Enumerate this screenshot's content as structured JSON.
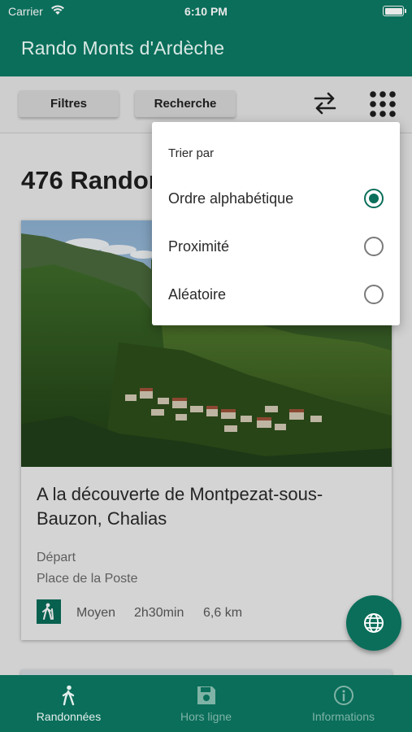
{
  "status_bar": {
    "carrier": "Carrier",
    "time": "6:10 PM"
  },
  "app_bar": {
    "title": "Rando Monts d'Ardèche"
  },
  "toolbar": {
    "filters_label": "Filtres",
    "search_label": "Recherche",
    "sort_icon": "swap-arrows-icon",
    "grid_icon": "grid-dots-icon"
  },
  "list": {
    "count_title": "476 Randonnées"
  },
  "cards": [
    {
      "name": "A la découverte de Montpezat-sous-Bauzon, Chalias",
      "depart_label": "Départ",
      "depart_value": "Place de la Poste",
      "activity_icon": "hiker-icon",
      "level": "Moyen",
      "duration": "2h30min",
      "distance": "6,6 km"
    }
  ],
  "sort_menu": {
    "heading": "Trier par",
    "options": [
      {
        "label": "Ordre alphabétique",
        "selected": true
      },
      {
        "label": "Proximité",
        "selected": false
      },
      {
        "label": "Aléatoire",
        "selected": false
      }
    ]
  },
  "fab": {
    "icon": "globe-icon"
  },
  "bottom_nav": {
    "items": [
      {
        "label": "Randonnées",
        "icon": "hiker-icon",
        "active": true
      },
      {
        "label": "Hors ligne",
        "icon": "save-icon",
        "active": false
      },
      {
        "label": "Informations",
        "icon": "info-icon",
        "active": false
      }
    ]
  },
  "colors": {
    "primary": "#0a6e5a",
    "background": "#eeeeee"
  }
}
